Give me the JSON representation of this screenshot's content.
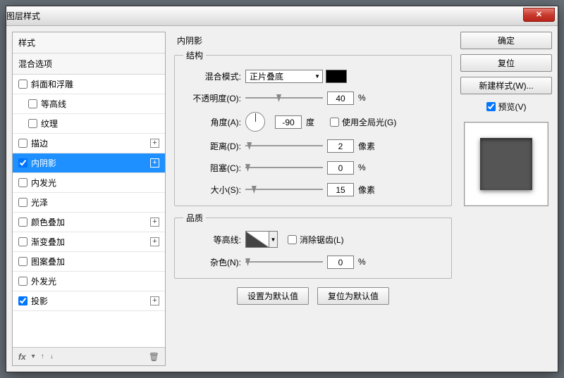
{
  "window": {
    "title": "图层样式"
  },
  "sidebar": {
    "header": "样式",
    "blend_options": "混合选项",
    "items": [
      {
        "label": "斜面和浮雕",
        "checked": false,
        "expandable": false
      },
      {
        "label": "等高线",
        "checked": false,
        "indent": true
      },
      {
        "label": "纹理",
        "checked": false,
        "indent": true
      },
      {
        "label": "描边",
        "checked": false,
        "expandable": true
      },
      {
        "label": "内阴影",
        "checked": true,
        "expandable": true,
        "selected": true
      },
      {
        "label": "内发光",
        "checked": false
      },
      {
        "label": "光泽",
        "checked": false
      },
      {
        "label": "颜色叠加",
        "checked": false,
        "expandable": true
      },
      {
        "label": "渐变叠加",
        "checked": false,
        "expandable": true
      },
      {
        "label": "图案叠加",
        "checked": false
      },
      {
        "label": "外发光",
        "checked": false
      },
      {
        "label": "投影",
        "checked": true,
        "expandable": true
      }
    ],
    "footer": {
      "fx": "fx"
    }
  },
  "panel": {
    "title": "内阴影",
    "structure": {
      "legend": "结构",
      "blend_mode_label": "混合模式:",
      "blend_mode_value": "正片叠底",
      "opacity_label": "不透明度(O):",
      "opacity_value": "40",
      "opacity_unit": "%",
      "angle_label": "角度(A):",
      "angle_value": "-90",
      "angle_unit": "度",
      "global_light_label": "使用全局光(G)",
      "distance_label": "距离(D):",
      "distance_value": "2",
      "distance_unit": "像素",
      "choke_label": "阻塞(C):",
      "choke_value": "0",
      "choke_unit": "%",
      "size_label": "大小(S):",
      "size_value": "15",
      "size_unit": "像素"
    },
    "quality": {
      "legend": "品质",
      "contour_label": "等高线:",
      "antialias_label": "消除锯齿(L)",
      "noise_label": "杂色(N):",
      "noise_value": "0",
      "noise_unit": "%"
    },
    "default_btn": "设置为默认值",
    "reset_btn": "复位为默认值"
  },
  "buttons": {
    "ok": "确定",
    "reset": "复位",
    "new_style": "新建样式(W)...",
    "preview": "预览(V)"
  }
}
